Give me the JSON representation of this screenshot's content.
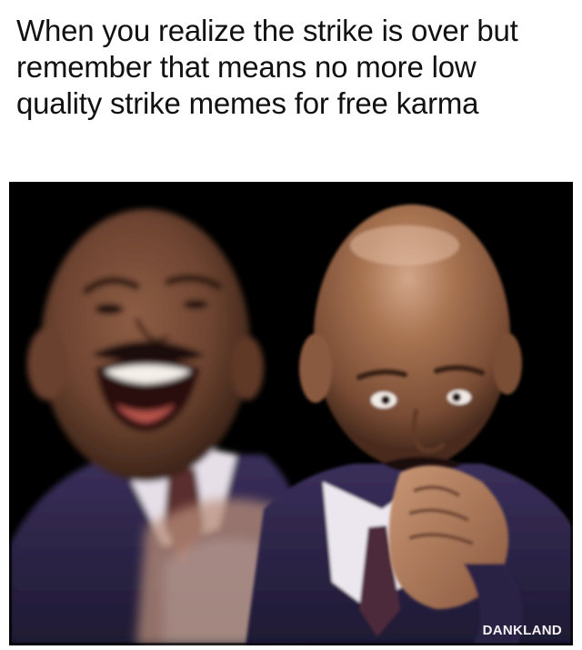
{
  "meme": {
    "caption": "When you realize the strike is over but remember that means no more low quality strike memes for free karma",
    "watermark": "DANKLAND"
  },
  "colors": {
    "background": "#ffffff",
    "caption_text": "#111111",
    "photo_background": "#000000",
    "suit": "#2b2446",
    "skin": "#9a6a4c",
    "shirt": "#e8e2ea"
  }
}
